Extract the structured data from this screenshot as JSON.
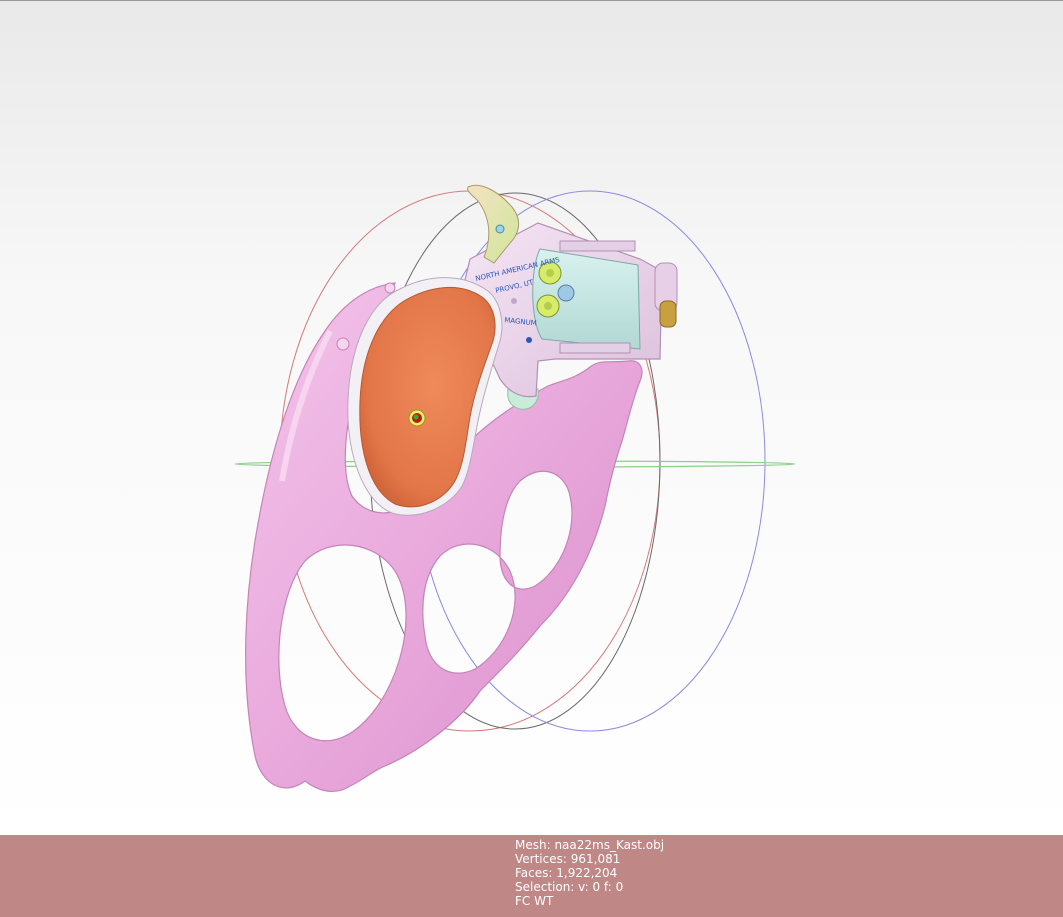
{
  "viewport": {
    "model": "pink knuckle-duster frame with mini revolver",
    "engraving": {
      "line1": "NORTH AMERICAN ARMS",
      "line2": "PROVO, UT",
      "caliber": "22 MAGNUM"
    },
    "colors": {
      "frame": "#e9a9dc",
      "grip": "#e27648",
      "body": "#e9d3ea",
      "cylinder": "#c9e9e6",
      "cartridge": "#d6ec6a",
      "trackball_red": "#d47a7a",
      "trackball_grey": "#6a6a6a",
      "trackball_blue": "#8a8ae0",
      "trackball_green": "#8ad08a"
    }
  },
  "status": {
    "mesh": "Mesh: naa22ms_Kast.obj",
    "vertices": "Vertices: 961,081",
    "faces": "Faces: 1,922,204",
    "selection": "Selection: v: 0 f: 0",
    "mode": "FC WT",
    "background": "#bf8786"
  }
}
